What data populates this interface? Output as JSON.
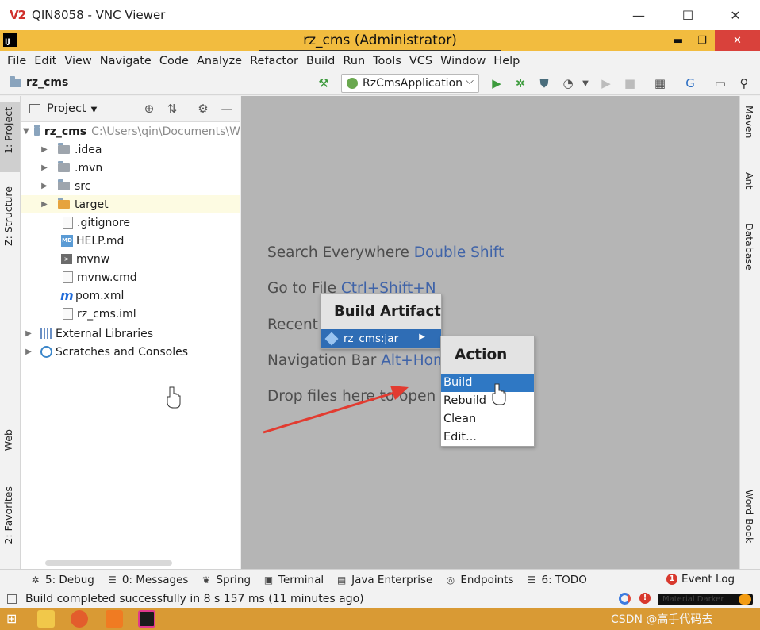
{
  "vnc": {
    "logo": "V2",
    "title": "QIN8058 - VNC Viewer",
    "minimize": "—",
    "maximize": "☐",
    "close": "✕"
  },
  "ide": {
    "logo": "IJ",
    "title": "rz_cms (Administrator)",
    "minimize": "▬",
    "restore": "❐",
    "close": "✕"
  },
  "menu": [
    "File",
    "Edit",
    "View",
    "Navigate",
    "Code",
    "Analyze",
    "Refactor",
    "Build",
    "Run",
    "Tools",
    "VCS",
    "Window",
    "Help"
  ],
  "nav": {
    "project": "rz_cms",
    "run_config": "RzCmsApplication",
    "dropdown": "⌵"
  },
  "left_stripe": {
    "project": "1: Project",
    "structure": "Z: Structure",
    "web": "Web",
    "favorites": "2: Favorites"
  },
  "right_stripe": {
    "maven": "Maven",
    "ant": "Ant",
    "database": "Database",
    "wordbook": "Word Book"
  },
  "project_panel": {
    "title": "Project",
    "tree": [
      {
        "name": "rz_cms",
        "path": "C:\\Users\\qin\\Documents\\W"
      },
      {
        "name": ".idea"
      },
      {
        "name": ".mvn"
      },
      {
        "name": "src"
      },
      {
        "name": "target"
      },
      {
        "name": ".gitignore"
      },
      {
        "name": "HELP.md",
        "badge": "MD"
      },
      {
        "name": "mvnw"
      },
      {
        "name": "mvnw.cmd"
      },
      {
        "name": "pom.xml",
        "badge": "m"
      },
      {
        "name": "rz_cms.iml"
      },
      {
        "name": "External Libraries"
      },
      {
        "name": "Scratches and Consoles"
      }
    ]
  },
  "editor_hints": [
    {
      "text": "Search Everywhere ",
      "key": "Double Shift"
    },
    {
      "text": "Go to File ",
      "key": "Ctrl+Shift+N"
    },
    {
      "text": "Recent ",
      "key": ""
    },
    {
      "text": "Navigation Bar ",
      "key": "Alt+Hom"
    },
    {
      "text": "Drop files here to open",
      "key": ""
    }
  ],
  "build_artifact_popup": {
    "title": "Build Artifact",
    "item": "rz_cms:jar",
    "submenu_arrow": "▶"
  },
  "action_popup": {
    "title": "Action",
    "items": [
      "Build",
      "Rebuild",
      "Clean",
      "Edit..."
    ]
  },
  "bottom_tabs": [
    {
      "icon": "✲",
      "label": "5: Debug"
    },
    {
      "icon": "☰",
      "label": "0: Messages"
    },
    {
      "icon": "❦",
      "label": "Spring"
    },
    {
      "icon": "▣",
      "label": "Terminal"
    },
    {
      "icon": "▤",
      "label": "Java Enterprise"
    },
    {
      "icon": "◎",
      "label": "Endpoints"
    },
    {
      "icon": "☰",
      "label": "6: TODO"
    }
  ],
  "event_log": {
    "count": "1",
    "label": "Event Log"
  },
  "status": {
    "text": "Build completed successfully in 8 s 157 ms (11 minutes ago)",
    "theme": "Material Darker"
  },
  "taskbar": {
    "watermark": "CSDN @高手代码去"
  },
  "colors": {
    "ide_title": "#f2bc3f",
    "editor_bg": "#b5b5b5",
    "selection": "#2f78c4",
    "key_blue": "#3f63a8",
    "annotation": "#e23b30"
  }
}
